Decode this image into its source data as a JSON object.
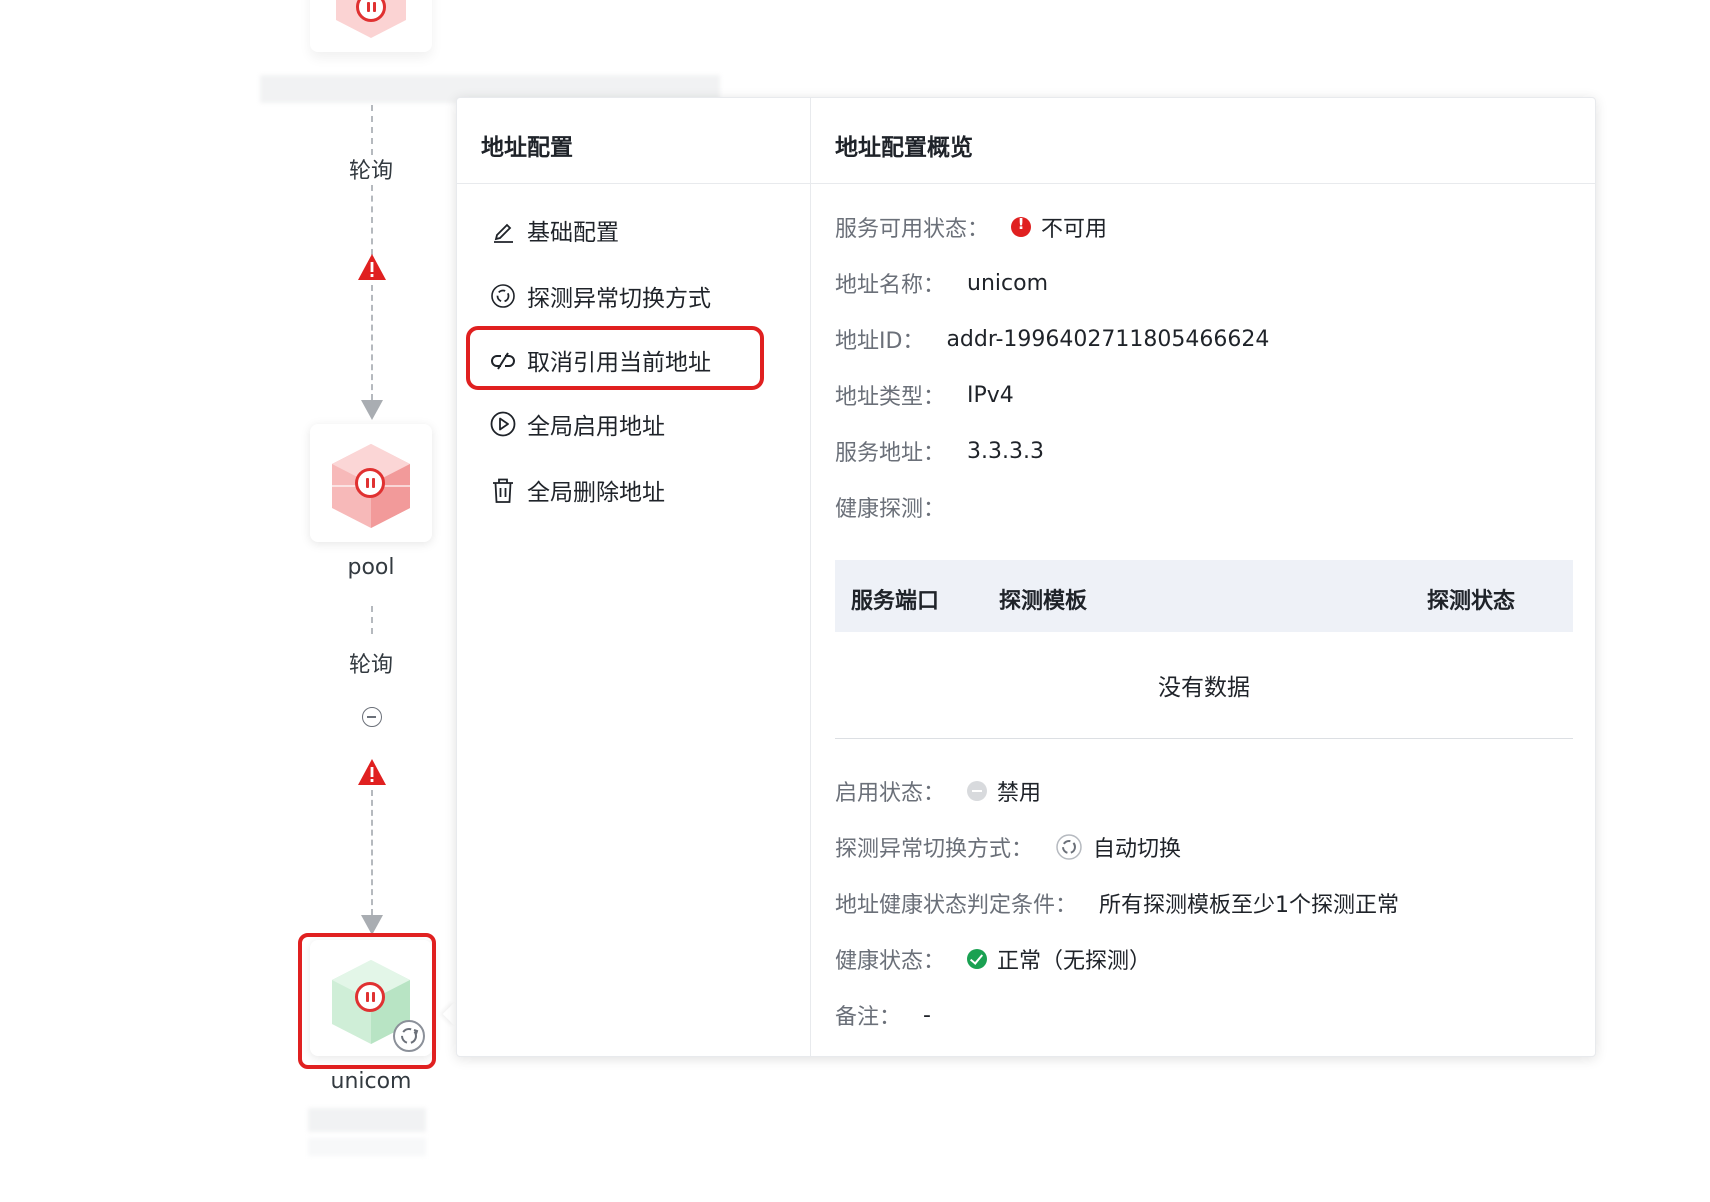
{
  "flow": {
    "edge_label_1": "轮询",
    "edge_label_2": "轮询",
    "node_pool_label": "pool",
    "node_unicom_label": "unicom",
    "colors": {
      "alert": "#e02020",
      "node_red": "#f5a3a3",
      "node_green": "#a8dcb6"
    }
  },
  "menu": {
    "title": "地址配置",
    "items": [
      {
        "label": "基础配置",
        "icon": "edit-icon"
      },
      {
        "label": "探测异常切换方式",
        "icon": "switch-mode-icon"
      },
      {
        "label": "取消引用当前地址",
        "icon": "unlink-icon",
        "highlighted": true
      },
      {
        "label": "全局启用地址",
        "icon": "play-circle-icon"
      },
      {
        "label": "全局删除地址",
        "icon": "trash-icon"
      }
    ]
  },
  "overview": {
    "title": "地址配置概览",
    "service_status": {
      "label": "服务可用状态：",
      "value": "不可用"
    },
    "addr_name": {
      "label": "地址名称：",
      "value": "unicom"
    },
    "addr_id": {
      "label": "地址ID：",
      "value": "addr-1996402711805466624"
    },
    "addr_type": {
      "label": "地址类型：",
      "value": "IPv4"
    },
    "service_addr": {
      "label": "服务地址：",
      "value": "3.3.3.3"
    },
    "health_probe": {
      "label": "健康探测："
    },
    "table": {
      "headers": [
        "服务端口",
        "探测模板",
        "探测状态"
      ],
      "empty_text": "没有数据"
    },
    "enable_status": {
      "label": "启用状态：",
      "value": "禁用"
    },
    "switch_mode": {
      "label": "探测异常切换方式：",
      "value": "自动切换"
    },
    "health_condition": {
      "label": "地址健康状态判定条件：",
      "value": "所有探测模板至少1个探测正常"
    },
    "health_status": {
      "label": "健康状态：",
      "value": "正常（无探测）"
    },
    "remark": {
      "label": "备注：",
      "value": "-"
    }
  }
}
